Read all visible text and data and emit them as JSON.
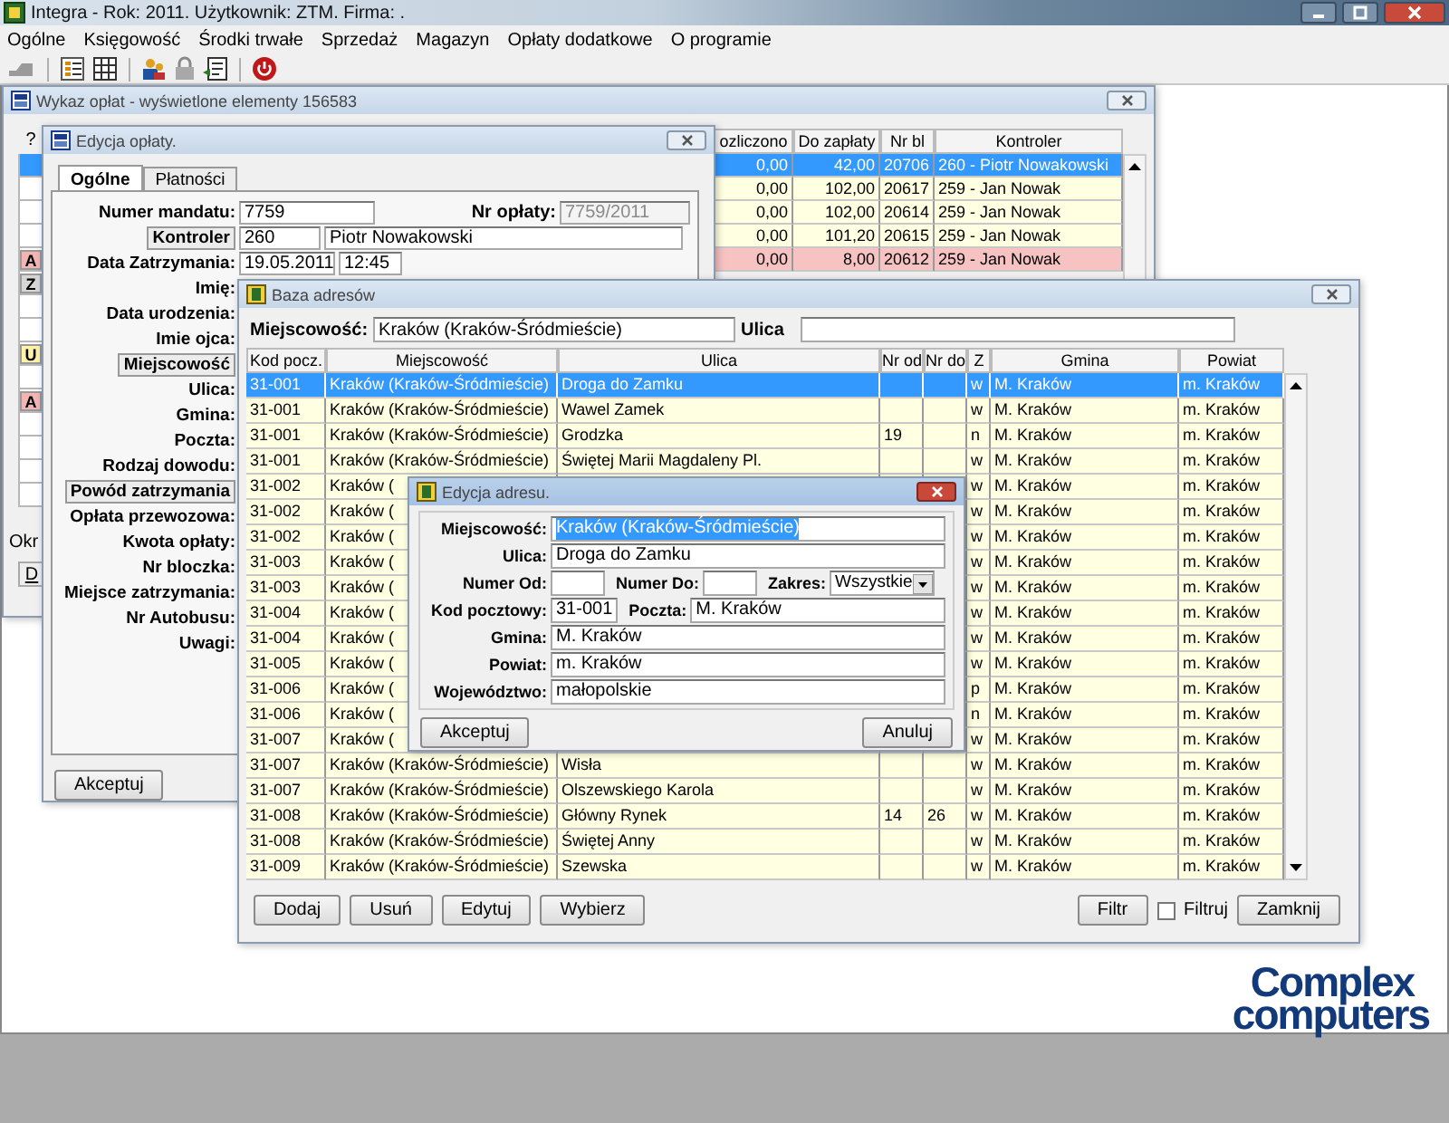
{
  "app": {
    "title": "Integra -  Rok: 2011. Użytkownik: ZTM. Firma: ."
  },
  "menu": [
    "Ogólne",
    "Księgowość",
    "Środki trwałe",
    "Sprzedaż",
    "Magazyn",
    "Opłaty dodatkowe",
    "O programie"
  ],
  "wykaz": {
    "title": "Wykaz opłat - wyświetlone elementy 156583",
    "mark_header": "?",
    "columns": [
      "ozliczono",
      "Do zapłaty",
      "Nr bl",
      "Kontroler"
    ],
    "rows": [
      {
        "selected": true,
        "cells": [
          "0,00",
          "42,00",
          "20706",
          "260 - Piotr Nowakowski"
        ]
      },
      {
        "selected": false,
        "color": "#ffffe1",
        "cells": [
          "0,00",
          "102,00",
          "20617",
          "259 - Jan Nowak"
        ]
      },
      {
        "selected": false,
        "color": "#ffffe1",
        "cells": [
          "0,00",
          "102,00",
          "20614",
          "259 - Jan Nowak"
        ]
      },
      {
        "selected": false,
        "color": "#ffffe1",
        "cells": [
          "0,00",
          "101,20",
          "20615",
          "259 - Jan Nowak"
        ]
      },
      {
        "selected": false,
        "color": "#f6c2c2",
        "mark": {
          "text": "A",
          "color": "#f4b4b4"
        },
        "cells": [
          "0,00",
          "8,00",
          "20612",
          "259 - Jan Nowak"
        ]
      },
      {
        "selected": false,
        "mark": {
          "text": "Z",
          "color": "#d6d6d6"
        }
      },
      {
        "selected": false
      },
      {
        "selected": false
      },
      {
        "selected": false,
        "mark": {
          "text": "U",
          "color": "#fff3a8"
        }
      },
      {
        "selected": false
      },
      {
        "selected": false,
        "mark": {
          "text": "A",
          "color": "#f4b4b4"
        }
      },
      {
        "selected": false
      },
      {
        "selected": false
      },
      {
        "selected": false
      },
      {
        "selected": false
      }
    ],
    "footer_label": "Okr",
    "footer_button": "D"
  },
  "edycja_oplaty": {
    "title": "Edycja opłaty.",
    "tabs": [
      {
        "label": "Ogólne",
        "selected": true
      },
      {
        "label": "Płatności",
        "selected": false
      }
    ],
    "rows": [
      {
        "label": "Numer mandatu:",
        "kind": "label",
        "values": [
          "7759"
        ],
        "side": {
          "label": "Nr opłaty:",
          "value": "7759/2011",
          "disabled": true
        }
      },
      {
        "label": "Kontroler",
        "kind": "button",
        "values": [
          "260",
          "Piotr Nowakowski"
        ]
      },
      {
        "label": "Data Zatrzymania:",
        "kind": "label",
        "values": [
          "19.05.2011",
          "12:45"
        ]
      },
      {
        "label": "Imię:",
        "kind": "label"
      },
      {
        "label": "Data urodzenia:",
        "kind": "label"
      },
      {
        "label": "Imie ojca:",
        "kind": "label"
      },
      {
        "label": "Miejscowość",
        "kind": "button"
      },
      {
        "label": "Ulica:",
        "kind": "label"
      },
      {
        "label": "Gmina:",
        "kind": "label"
      },
      {
        "label": "Poczta:",
        "kind": "label"
      },
      {
        "label": "Rodzaj dowodu:",
        "kind": "label"
      },
      {
        "label": "Powód zatrzymania",
        "kind": "button"
      },
      {
        "label": "Opłata przewozowa:",
        "kind": "label"
      },
      {
        "label": "Kwota opłaty:",
        "kind": "label"
      },
      {
        "label": "Nr bloczka:",
        "kind": "label"
      },
      {
        "label": "Miejsce zatrzymania:",
        "kind": "label"
      },
      {
        "label": "Nr Autobusu:",
        "kind": "label"
      },
      {
        "label": "Uwagi:",
        "kind": "label"
      }
    ],
    "accept": "Akceptuj"
  },
  "baza": {
    "title": "Baza adresów",
    "filters": [
      {
        "label": "Miejscowość:",
        "value": "Kraków (Kraków-Śródmieście)"
      },
      {
        "label": "Ulica"
      }
    ],
    "columns": [
      "Kod pocz.",
      "Miejscowość",
      "Ulica",
      "Nr od",
      "Nr do",
      "Z",
      "Gmina",
      "Powiat"
    ],
    "rows": [
      {
        "selected": true,
        "kod": "31-001",
        "miejscowosc": "Kraków (Kraków-Śródmieście)",
        "ulica": "Droga do Zamku",
        "z": "w",
        "gmina": "M. Kraków",
        "powiat": "m. Kraków"
      },
      {
        "selected": false,
        "kod": "31-001",
        "miejscowosc": "Kraków (Kraków-Śródmieście)",
        "ulica": "Wawel Zamek",
        "z": "w",
        "gmina": "M. Kraków",
        "powiat": "m. Kraków"
      },
      {
        "selected": false,
        "kod": "31-001",
        "miejscowosc": "Kraków (Kraków-Śródmieście)",
        "ulica": "Grodzka",
        "nr_od": "19",
        "z": "n",
        "gmina": "M. Kraków",
        "powiat": "m. Kraków"
      },
      {
        "selected": false,
        "kod": "31-001",
        "miejscowosc": "Kraków (Kraków-Śródmieście)",
        "ulica": "Świętej Marii Magdaleny Pl.",
        "z": "w",
        "gmina": "M. Kraków",
        "powiat": "m. Kraków"
      },
      {
        "selected": false,
        "kod": "31-002",
        "miejscowosc": "Kraków (",
        "z": "w",
        "gmina": "M. Kraków",
        "powiat": "m. Kraków"
      },
      {
        "selected": false,
        "kod": "31-002",
        "miejscowosc": "Kraków (",
        "z": "w",
        "gmina": "M. Kraków",
        "powiat": "m. Kraków"
      },
      {
        "selected": false,
        "kod": "31-002",
        "miejscowosc": "Kraków (",
        "z": "w",
        "gmina": "M. Kraków",
        "powiat": "m. Kraków"
      },
      {
        "selected": false,
        "kod": "31-003",
        "miejscowosc": "Kraków (",
        "z": "w",
        "gmina": "M. Kraków",
        "powiat": "m. Kraków"
      },
      {
        "selected": false,
        "kod": "31-003",
        "miejscowosc": "Kraków (",
        "z": "w",
        "gmina": "M. Kraków",
        "powiat": "m. Kraków"
      },
      {
        "selected": false,
        "kod": "31-004",
        "miejscowosc": "Kraków (",
        "z": "w",
        "gmina": "M. Kraków",
        "powiat": "m. Kraków"
      },
      {
        "selected": false,
        "kod": "31-004",
        "miejscowosc": "Kraków (",
        "z": "w",
        "gmina": "M. Kraków",
        "powiat": "m. Kraków"
      },
      {
        "selected": false,
        "kod": "31-005",
        "miejscowosc": "Kraków (",
        "z": "w",
        "gmina": "M. Kraków",
        "powiat": "m. Kraków"
      },
      {
        "selected": false,
        "kod": "31-006",
        "miejscowosc": "Kraków (",
        "z": "p",
        "gmina": "M. Kraków",
        "powiat": "m. Kraków"
      },
      {
        "selected": false,
        "kod": "31-006",
        "miejscowosc": "Kraków (",
        "z": "n",
        "gmina": "M. Kraków",
        "powiat": "m. Kraków"
      },
      {
        "selected": false,
        "kod": "31-007",
        "miejscowosc": "Kraków (",
        "z": "w",
        "gmina": "M. Kraków",
        "powiat": "m. Kraków"
      },
      {
        "selected": false,
        "kod": "31-007",
        "miejscowosc": "Kraków (Kraków-Śródmieście)",
        "ulica": "Wisła",
        "z": "w",
        "gmina": "M. Kraków",
        "powiat": "m. Kraków"
      },
      {
        "selected": false,
        "kod": "31-007",
        "miejscowosc": "Kraków (Kraków-Śródmieście)",
        "ulica": "Olszewskiego Karola",
        "z": "w",
        "gmina": "M. Kraków",
        "powiat": "m. Kraków"
      },
      {
        "selected": false,
        "kod": "31-008",
        "miejscowosc": "Kraków (Kraków-Śródmieście)",
        "ulica": "Główny Rynek",
        "nr_od": "14",
        "nr_do": "26",
        "z": "w",
        "gmina": "M. Kraków",
        "powiat": "m. Kraków"
      },
      {
        "selected": false,
        "kod": "31-008",
        "miejscowosc": "Kraków (Kraków-Śródmieście)",
        "ulica": "Świętej Anny",
        "z": "w",
        "gmina": "M. Kraków",
        "powiat": "m. Kraków"
      },
      {
        "selected": false,
        "kod": "31-009",
        "miejscowosc": "Kraków (Kraków-Śródmieście)",
        "ulica": "Szewska",
        "z": "w",
        "gmina": "M. Kraków",
        "powiat": "m. Kraków"
      }
    ],
    "buttons": [
      "Dodaj",
      "Usuń",
      "Edytuj",
      "Wybierz"
    ],
    "filter_button": "Filtr",
    "filter_check": {
      "label": "Filtruj",
      "checked": false
    },
    "close_button": "Zamknij"
  },
  "adres": {
    "title": "Edycja adresu.",
    "rows": [
      [
        {
          "label": "Miejscowość:",
          "kind": "text",
          "value": "Kraków (Kraków-Śródmieście)",
          "text_selected": true
        }
      ],
      [
        {
          "label": "Ulica:",
          "kind": "text",
          "value": "Droga do Zamku"
        }
      ],
      [
        {
          "label": "Numer Od:",
          "kind": "text"
        },
        {
          "label": "Numer Do:",
          "kind": "text"
        },
        {
          "label": "Zakres:",
          "kind": "select",
          "value": "Wszystkie"
        }
      ],
      [
        {
          "label": "Kod pocztowy:",
          "kind": "text",
          "value": "31-001"
        },
        {
          "label": "Poczta:",
          "kind": "text",
          "value": "M. Kraków"
        }
      ],
      [
        {
          "label": "Gmina:",
          "kind": "text",
          "value": "M. Kraków"
        }
      ],
      [
        {
          "label": "Powiat:",
          "kind": "text",
          "value": "m. Kraków"
        }
      ],
      [
        {
          "label": "Województwo:",
          "kind": "text",
          "value": "małopolskie"
        }
      ]
    ],
    "buttons": [
      "Akceptuj",
      "Anuluj"
    ]
  },
  "logo": [
    "Complex",
    "computers"
  ]
}
